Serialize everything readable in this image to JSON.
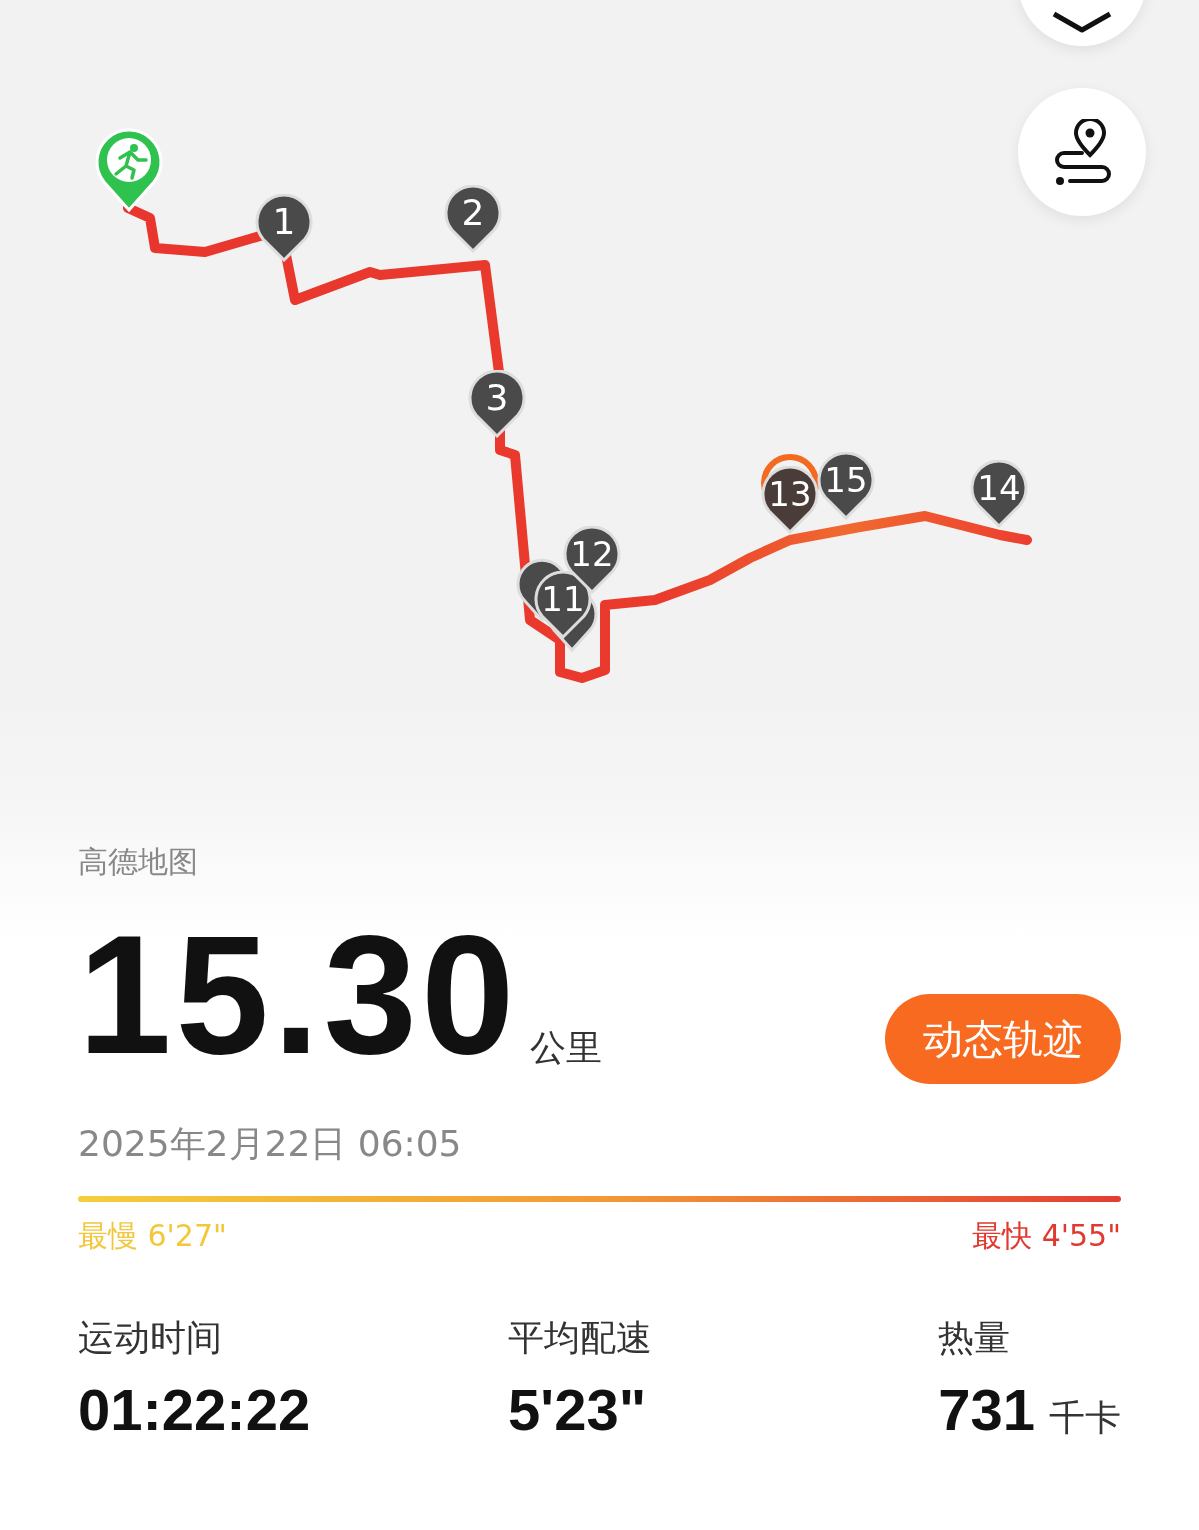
{
  "map": {
    "markers": [
      {
        "label": "1",
        "selected": false
      },
      {
        "label": "2",
        "selected": false
      },
      {
        "label": "3",
        "selected": false
      },
      {
        "label": "11",
        "selected": false
      },
      {
        "label": "12",
        "selected": false
      },
      {
        "label": "13",
        "selected": true
      },
      {
        "label": "15",
        "selected": false
      },
      {
        "label": "14",
        "selected": false
      }
    ]
  },
  "map_source": "高德地图",
  "distance": {
    "value": "15.30",
    "unit": "公里"
  },
  "track_button": "动态轨迹",
  "date": "2025年2月22日 06:05",
  "pace_bar": {
    "slowest": "最慢 6'27\"",
    "fastest": "最快 4'55\""
  },
  "stats": [
    {
      "label": "运动时间",
      "value": "01:22:22"
    },
    {
      "label": "平均配速",
      "value": "5'23\""
    },
    {
      "label": "热量",
      "value": "731",
      "unit": "千卡"
    }
  ]
}
